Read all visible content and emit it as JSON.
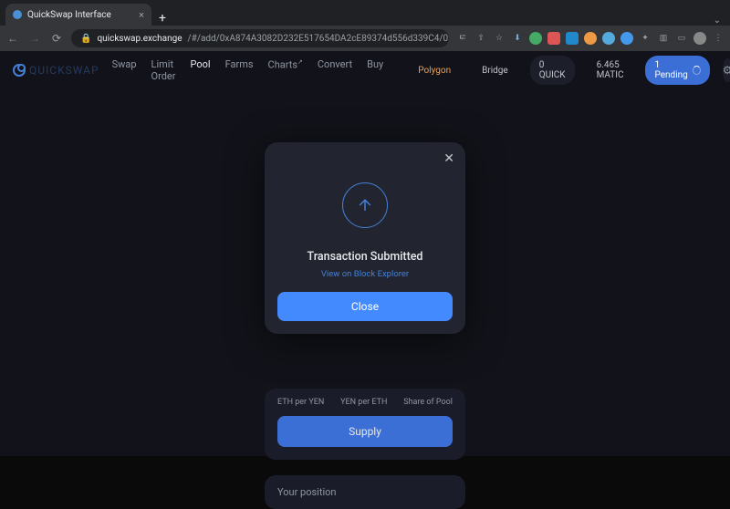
{
  "browser": {
    "tab_title": "QuickSwap Interface",
    "url_host": "quickswap.exchange",
    "url_path": "/#/add/0xA874A3082D232E517654DA2cE89374d556d339C4/0x7ceB23fD6bC0adD59E82ac2557..."
  },
  "nav": {
    "logo": "QUICKSWAP",
    "items": [
      "Swap",
      "Limit Order",
      "Pool",
      "Farms",
      "Charts",
      "Convert",
      "Buy"
    ],
    "active_index": 2
  },
  "header": {
    "network": "Polygon",
    "bridge": "Bridge",
    "quick": "0 QUICK",
    "matic": "6.465 MATIC",
    "pending": "1 Pending"
  },
  "prices": {
    "a": "ETH per YEN",
    "b": "YEN per ETH",
    "c": "Share of Pool"
  },
  "supply_label": "Supply",
  "position_label": "Your position",
  "modal": {
    "title": "Transaction Submitted",
    "link": "View on Block Explorer",
    "close": "Close"
  }
}
